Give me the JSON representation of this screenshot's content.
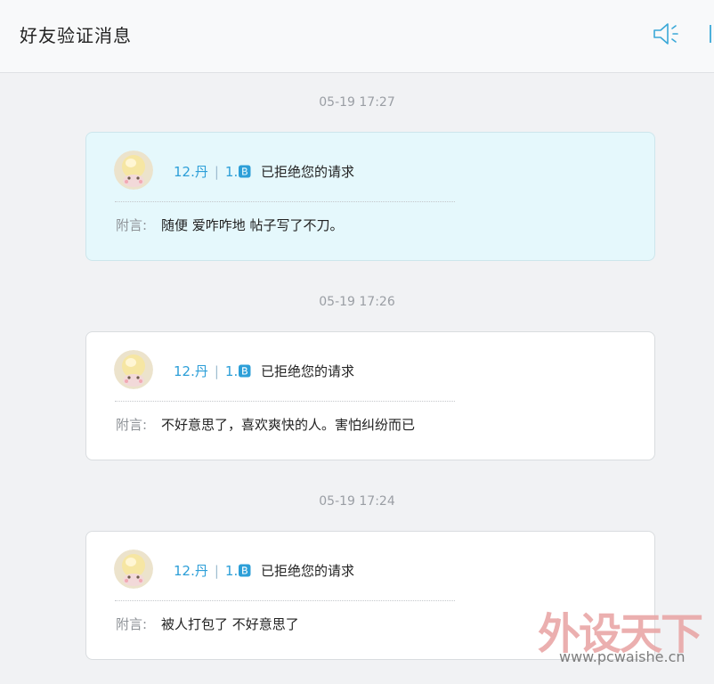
{
  "header": {
    "title": "好友验证消息",
    "speaker_icon": "speaker-icon",
    "accent_color": "#3aa8d8"
  },
  "messages": [
    {
      "time": "05-19 17:27",
      "nick_part1": "12.丹",
      "nick_sep": "|",
      "nick_part2": "1.🅱",
      "action": "已拒绝您的请求",
      "note_label": "附言:",
      "note": "随便 爱咋咋地 帖子写了不刀。",
      "highlighted": true
    },
    {
      "time": "05-19 17:26",
      "nick_part1": "12.丹",
      "nick_sep": "|",
      "nick_part2": "1.🅱",
      "action": "已拒绝您的请求",
      "note_label": "附言:",
      "note": "不好意思了，喜欢爽快的人。害怕纠纷而已",
      "highlighted": false
    },
    {
      "time": "05-19 17:24",
      "nick_part1": "12.丹",
      "nick_sep": "|",
      "nick_part2": "1.🅱",
      "action": "已拒绝您的请求",
      "note_label": "附言:",
      "note": "被人打包了 不好意思了",
      "highlighted": false
    }
  ],
  "watermark": {
    "brand": "外设天下",
    "url": "www.pcwaishe.cn"
  }
}
